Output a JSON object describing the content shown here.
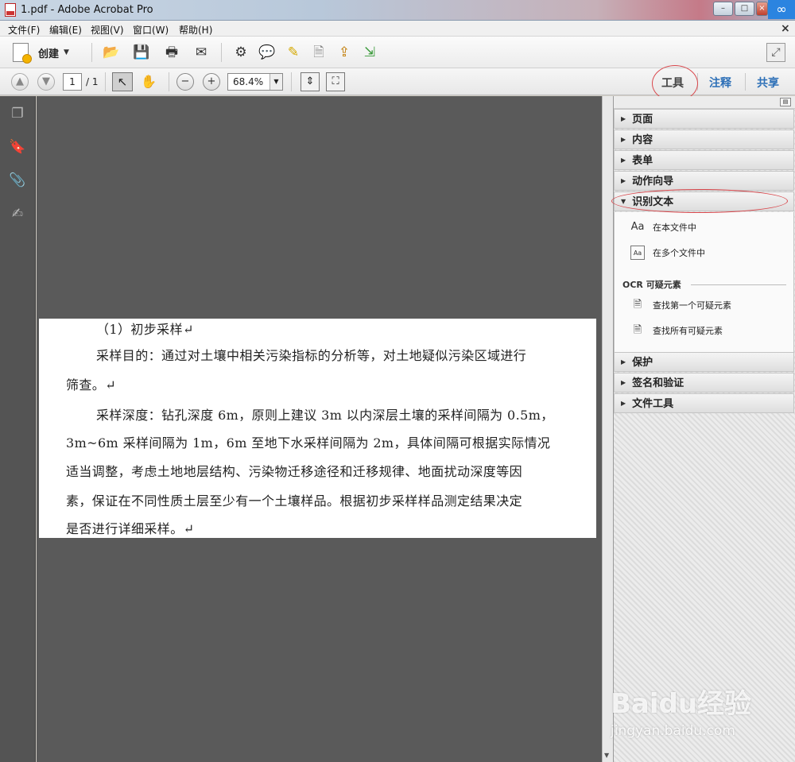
{
  "window": {
    "title": "1.pdf - Adobe Acrobat Pro",
    "min": "–",
    "max": "□",
    "close": "×",
    "cloud_icon": "∞"
  },
  "menu": {
    "items": [
      "文件(F)",
      "编辑(E)",
      "视图(V)",
      "窗口(W)",
      "帮助(H)"
    ],
    "close": "×"
  },
  "toolbar": {
    "create_label": "创建",
    "icons": [
      "open-folder-icon",
      "save-icon",
      "print-icon",
      "email-icon",
      "gear-icon",
      "comment-icon",
      "highlight-icon",
      "delete-file-icon",
      "export-icon",
      "share-file-icon"
    ],
    "expand_icon": "expand-icon"
  },
  "nav": {
    "page_current": "1",
    "page_total": "/ 1",
    "zoom": "68.4%",
    "tabs": [
      "工具",
      "注释",
      "共享"
    ]
  },
  "document": {
    "lines": [
      "（1）初步采样↵",
      "采样目的：通过对土壤中相关污染指标的分析等，对土地疑似污染区域进行",
      "筛查。↵",
      "采样深度：钻孔深度 6m，原则上建议 3m 以内深层土壤的采样间隔为 0.5m，",
      "3m~6m 采样间隔为 1m，6m 至地下水采样间隔为 2m，具体间隔可根据实际情况",
      "适当调整，考虑土地地层结构、污染物迁移途径和迁移规律、地面扰动深度等因",
      "素，保证在不同性质土层至少有一个土壤样品。根据初步采样样品测定结果决定",
      "是否进行详细采样。↵"
    ]
  },
  "panel": {
    "sections_top": [
      "页面",
      "内容",
      "表单",
      "动作向导"
    ],
    "open_section": "识别文本",
    "options": [
      "在本文件中",
      "在多个文件中"
    ],
    "ocr_heading": "OCR 可疑元素",
    "ocr_options": [
      "查找第一个可疑元素",
      "查找所有可疑元素"
    ],
    "sections_bottom": [
      "保护",
      "签名和验证",
      "文件工具"
    ]
  },
  "watermark": {
    "brand": "Baidu经验",
    "url": "jingyan.baidu.com"
  },
  "colors": {
    "accent_blue": "#2c6fb7",
    "annotation_red": "#d9484d",
    "doc_bg": "#5a5a5a"
  }
}
